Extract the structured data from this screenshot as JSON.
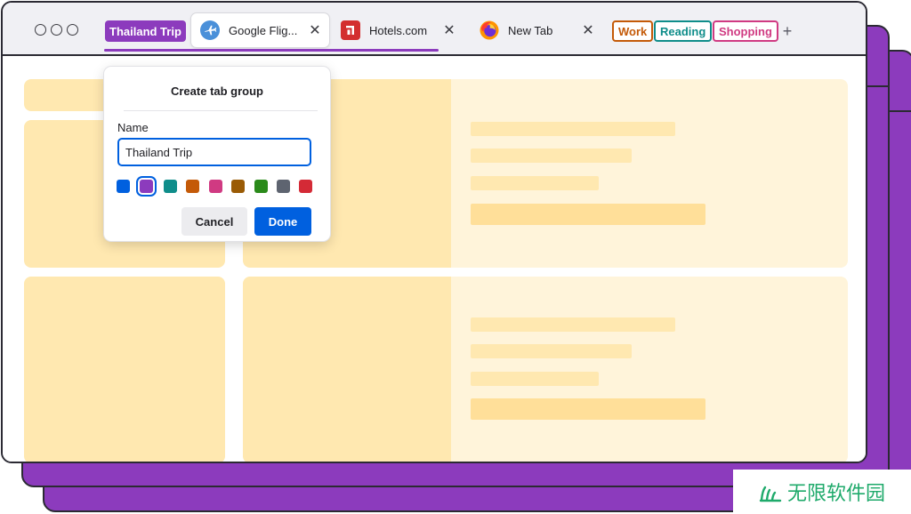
{
  "colors": {
    "group_purple": "#8c3bbd",
    "accent_blue": "#0060df",
    "placeholder": "#ffe8b0",
    "placeholder_light": "#fff4da"
  },
  "tabbar": {
    "active_group": {
      "label": "Thailand Trip",
      "color": "#8c3bbd"
    },
    "tabs": [
      {
        "title": "Google Flig...",
        "icon": "airplane-icon",
        "active": true
      },
      {
        "title": "Hotels.com",
        "icon": "hotels-logo-icon",
        "active": false
      },
      {
        "title": "New Tab",
        "icon": "firefox-icon",
        "active": false
      }
    ],
    "other_groups": [
      {
        "label": "Work",
        "color": "#c45a08"
      },
      {
        "label": "Reading",
        "color": "#0f8d8a"
      },
      {
        "label": "Shopping",
        "color": "#d03a82"
      }
    ],
    "close_glyph": "✕",
    "new_tab_glyph": "+"
  },
  "popup": {
    "title": "Create tab group",
    "name_label": "Name",
    "name_value": "Thailand Trip",
    "swatches": [
      "#0060df",
      "#8c3bbd",
      "#0f8d8a",
      "#c45a08",
      "#d03a82",
      "#9a5b05",
      "#2a8a1a",
      "#5e6470",
      "#d42a36"
    ],
    "selected_swatch": 1,
    "cancel_label": "Cancel",
    "done_label": "Done"
  },
  "watermark": {
    "text": "无限软件园"
  }
}
